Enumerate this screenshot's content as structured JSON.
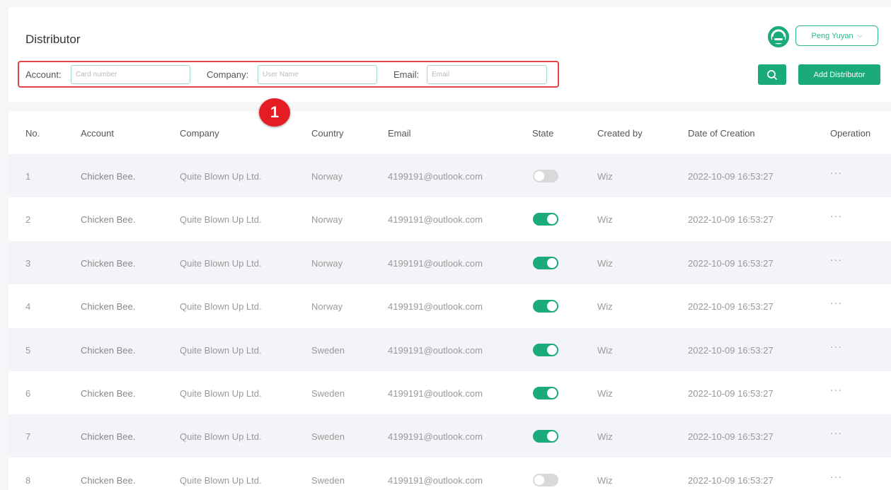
{
  "header": {
    "title": "Distributor",
    "user_name": "Peng Yuyan"
  },
  "filters": {
    "account_label": "Account:",
    "account_placeholder": "Card number",
    "company_label": "Company:",
    "company_placeholder": "User Name",
    "email_label": "Email:",
    "email_placeholder": "Email"
  },
  "annotation": {
    "badge": "1"
  },
  "actions": {
    "add_label": "Add Distributor"
  },
  "icons": {
    "avatar": "user-avatar-icon",
    "search": "search-icon",
    "dropdown": "chevron-down-icon",
    "more": "more-dots-icon"
  },
  "colors": {
    "accent": "#1aaa7c",
    "highlight": "#e0454a",
    "badge": "#e61c24"
  },
  "table": {
    "columns": [
      "No.",
      "Account",
      "Company",
      "Country",
      "Email",
      "State",
      "Created by",
      "Date of Creation",
      "Operation"
    ],
    "rows": [
      {
        "no": "1",
        "account": "Chicken Bee.",
        "company": "Quite Blown Up Ltd.",
        "country": "Norway",
        "email": "4199191@outlook.com",
        "state": false,
        "created_by": "Wiz",
        "date": "2022-10-09 16:53:27",
        "op": "···"
      },
      {
        "no": "2",
        "account": "Chicken Bee.",
        "company": "Quite Blown Up Ltd.",
        "country": "Norway",
        "email": "4199191@outlook.com",
        "state": true,
        "created_by": "Wiz",
        "date": "2022-10-09 16:53:27",
        "op": "···"
      },
      {
        "no": "3",
        "account": "Chicken Bee.",
        "company": "Quite Blown Up Ltd.",
        "country": "Norway",
        "email": "4199191@outlook.com",
        "state": true,
        "created_by": "Wiz",
        "date": "2022-10-09 16:53:27",
        "op": "···"
      },
      {
        "no": "4",
        "account": "Chicken Bee.",
        "company": "Quite Blown Up Ltd.",
        "country": "Norway",
        "email": "4199191@outlook.com",
        "state": true,
        "created_by": "Wiz",
        "date": "2022-10-09 16:53:27",
        "op": "···"
      },
      {
        "no": "5",
        "account": "Chicken Bee.",
        "company": "Quite Blown Up Ltd.",
        "country": "Sweden",
        "email": "4199191@outlook.com",
        "state": true,
        "created_by": "Wiz",
        "date": "2022-10-09 16:53:27",
        "op": "···"
      },
      {
        "no": "6",
        "account": "Chicken Bee.",
        "company": "Quite Blown Up Ltd.",
        "country": "Sweden",
        "email": "4199191@outlook.com",
        "state": true,
        "created_by": "Wiz",
        "date": "2022-10-09 16:53:27",
        "op": "···"
      },
      {
        "no": "7",
        "account": "Chicken Bee.",
        "company": "Quite Blown Up Ltd.",
        "country": "Sweden",
        "email": "4199191@outlook.com",
        "state": true,
        "created_by": "Wiz",
        "date": "2022-10-09 16:53:27",
        "op": "···"
      },
      {
        "no": "8",
        "account": "Chicken Bee.",
        "company": "Quite Blown Up Ltd.",
        "country": "Sweden",
        "email": "4199191@outlook.com",
        "state": false,
        "created_by": "Wiz",
        "date": "2022-10-09 16:53:27",
        "op": "···"
      }
    ]
  }
}
